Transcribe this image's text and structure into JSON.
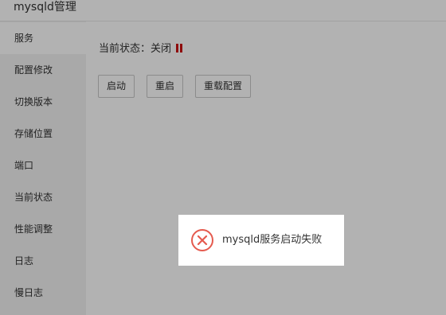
{
  "window": {
    "title": "mysqld管理"
  },
  "sidebar": {
    "items": [
      {
        "label": "服务",
        "active": true
      },
      {
        "label": "配置修改"
      },
      {
        "label": "切换版本"
      },
      {
        "label": "存储位置"
      },
      {
        "label": "端口"
      },
      {
        "label": "当前状态"
      },
      {
        "label": "性能调整"
      },
      {
        "label": "日志"
      },
      {
        "label": "慢日志"
      }
    ]
  },
  "main": {
    "status_label": "当前状态：关闭",
    "status_icon": "pause-icon",
    "status_color": "#cc1111",
    "buttons": {
      "start": "启动",
      "restart": "重启",
      "reload": "重载配置"
    }
  },
  "toast": {
    "icon": "error-circle-icon",
    "icon_color": "#e55a4e",
    "message": "mysqld服务启动失败"
  }
}
